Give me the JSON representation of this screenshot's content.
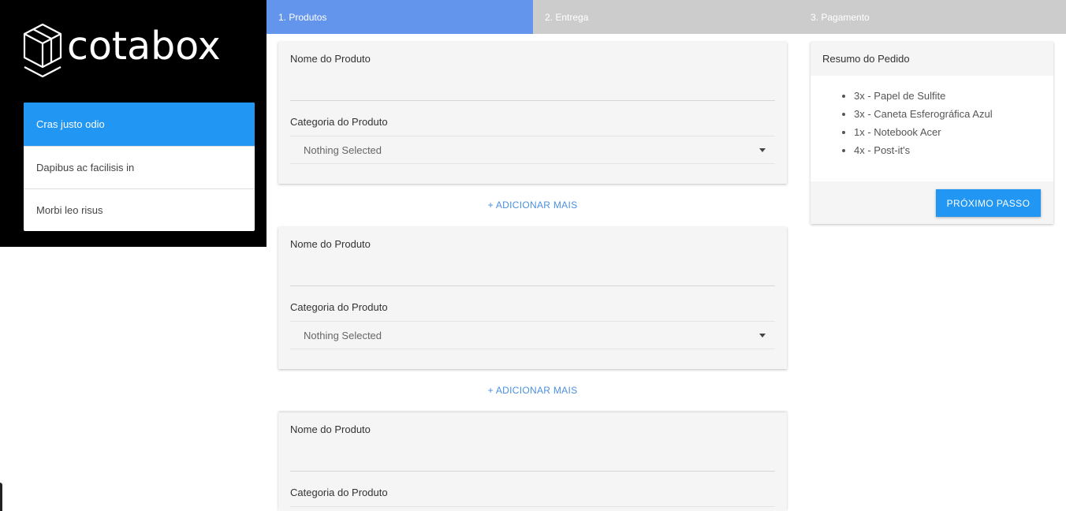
{
  "brand": {
    "name": "cotabox",
    "logo_icon": "cube-icon"
  },
  "sidebar": {
    "items": [
      {
        "label": "Cras justo odio",
        "active": true
      },
      {
        "label": "Dapibus ac facilisis in",
        "active": false
      },
      {
        "label": "Morbi leo risus",
        "active": false
      }
    ]
  },
  "stepper": {
    "steps": [
      {
        "label": "1. Produtos",
        "active": true
      },
      {
        "label": "2. Entrega",
        "active": false
      },
      {
        "label": "3. Pagamento",
        "active": false
      }
    ]
  },
  "products": [
    {
      "name_label": "Nome do Produto",
      "name_value": "",
      "category_label": "Categoria do Produto",
      "category_value": "Nothing Selected"
    },
    {
      "name_label": "Nome do Produto",
      "name_value": "",
      "category_label": "Categoria do Produto",
      "category_value": "Nothing Selected"
    },
    {
      "name_label": "Nome do Produto",
      "name_value": "",
      "category_label": "Categoria do Produto",
      "category_value": ""
    }
  ],
  "add_more_label": "+ ADICIONAR MAIS",
  "summary": {
    "title": "Resumo do Pedido",
    "items": [
      "3x - Papel de Sulfite",
      "3x - Caneta Esferográfica Azul",
      "1x - Notebook Acer",
      "4x - Post-it's"
    ],
    "next_button": "PRÓXIMO PASSO"
  },
  "colors": {
    "primary": "#2196f3",
    "step_active": "#6495ed",
    "step_inactive": "#cccccc",
    "link": "#4a90e2",
    "sidebar_bg": "#000000"
  }
}
